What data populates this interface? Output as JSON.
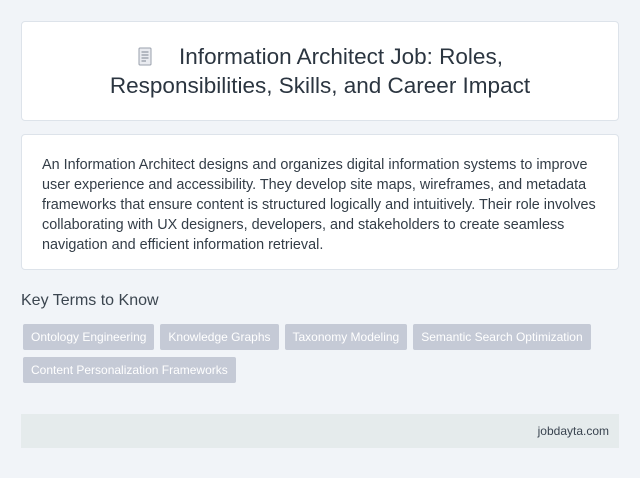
{
  "header": {
    "icon": "document-icon",
    "title": "Information Architect Job: Roles, Responsibilities, Skills, and Career Impact"
  },
  "summary": {
    "text": "An Information Architect designs and organizes digital information systems to improve user experience and accessibility. They develop site maps, wireframes, and metadata frameworks that ensure content is structured logically and intuitively. Their role involves collaborating with UX designers, developers, and stakeholders to create seamless navigation and efficient information retrieval."
  },
  "key_terms": {
    "heading": "Key Terms to Know",
    "tags": [
      "Ontology Engineering",
      "Knowledge Graphs",
      "Taxonomy Modeling",
      "Semantic Search Optimization",
      "Content Personalization Frameworks"
    ]
  },
  "footer": {
    "site": "jobdayta.com"
  },
  "colors": {
    "background": "#f1f4f8",
    "card": "#ffffff",
    "tag": "#c5cad6",
    "footer": "#e5ebec"
  }
}
